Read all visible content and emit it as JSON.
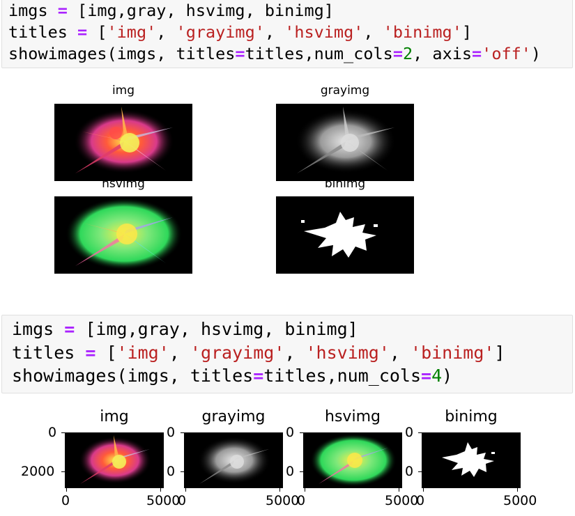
{
  "cell1": {
    "line1": [
      {
        "t": "imgs ",
        "c": ""
      },
      {
        "t": "=",
        "c": "op"
      },
      {
        "t": " [img,gray, hsvimg, binimg]",
        "c": ""
      }
    ],
    "line2": [
      {
        "t": "titles ",
        "c": ""
      },
      {
        "t": "=",
        "c": "op"
      },
      {
        "t": " [",
        "c": ""
      },
      {
        "t": "'img'",
        "c": "str"
      },
      {
        "t": ", ",
        "c": ""
      },
      {
        "t": "'grayimg'",
        "c": "str"
      },
      {
        "t": ", ",
        "c": ""
      },
      {
        "t": "'hsvimg'",
        "c": "str"
      },
      {
        "t": ", ",
        "c": ""
      },
      {
        "t": "'binimg'",
        "c": "str"
      },
      {
        "t": "]",
        "c": ""
      }
    ],
    "line3": [
      {
        "t": "showimages(imgs, titles",
        "c": ""
      },
      {
        "t": "=",
        "c": "op"
      },
      {
        "t": "titles,num_cols",
        "c": ""
      },
      {
        "t": "=",
        "c": "op"
      },
      {
        "t": "2",
        "c": "num"
      },
      {
        "t": ", axis",
        "c": ""
      },
      {
        "t": "=",
        "c": "op"
      },
      {
        "t": "'off'",
        "c": "str"
      },
      {
        "t": ")",
        "c": ""
      }
    ]
  },
  "output1": {
    "titles": [
      "img",
      "grayimg",
      "hsvimg",
      "binimg"
    ]
  },
  "cell2": {
    "line1": [
      {
        "t": "imgs ",
        "c": ""
      },
      {
        "t": "=",
        "c": "op"
      },
      {
        "t": " [img,gray, hsvimg, binimg]",
        "c": ""
      }
    ],
    "line2": [
      {
        "t": "titles ",
        "c": ""
      },
      {
        "t": "=",
        "c": "op"
      },
      {
        "t": " [",
        "c": ""
      },
      {
        "t": "'img'",
        "c": "str"
      },
      {
        "t": ", ",
        "c": ""
      },
      {
        "t": "'grayimg'",
        "c": "str"
      },
      {
        "t": ", ",
        "c": ""
      },
      {
        "t": "'hsvimg'",
        "c": "str"
      },
      {
        "t": ", ",
        "c": ""
      },
      {
        "t": "'binimg'",
        "c": "str"
      },
      {
        "t": "]",
        "c": ""
      }
    ],
    "line3": [
      {
        "t": "showimages(imgs, titles",
        "c": ""
      },
      {
        "t": "=",
        "c": "op"
      },
      {
        "t": "titles,num_cols",
        "c": ""
      },
      {
        "t": "=",
        "c": "op"
      },
      {
        "t": "4",
        "c": "num"
      },
      {
        "t": ")",
        "c": ""
      }
    ]
  },
  "output2": {
    "titles": [
      "img",
      "grayimg",
      "hsvimg",
      "binimg"
    ],
    "y_ticks": [
      "0",
      "2000"
    ],
    "x_ticks": [
      "0",
      "5000"
    ]
  },
  "colors": {
    "cell_bg": "#f7f7f7",
    "operator": "#aa22ff",
    "string": "#ba2121",
    "number": "#008000"
  }
}
